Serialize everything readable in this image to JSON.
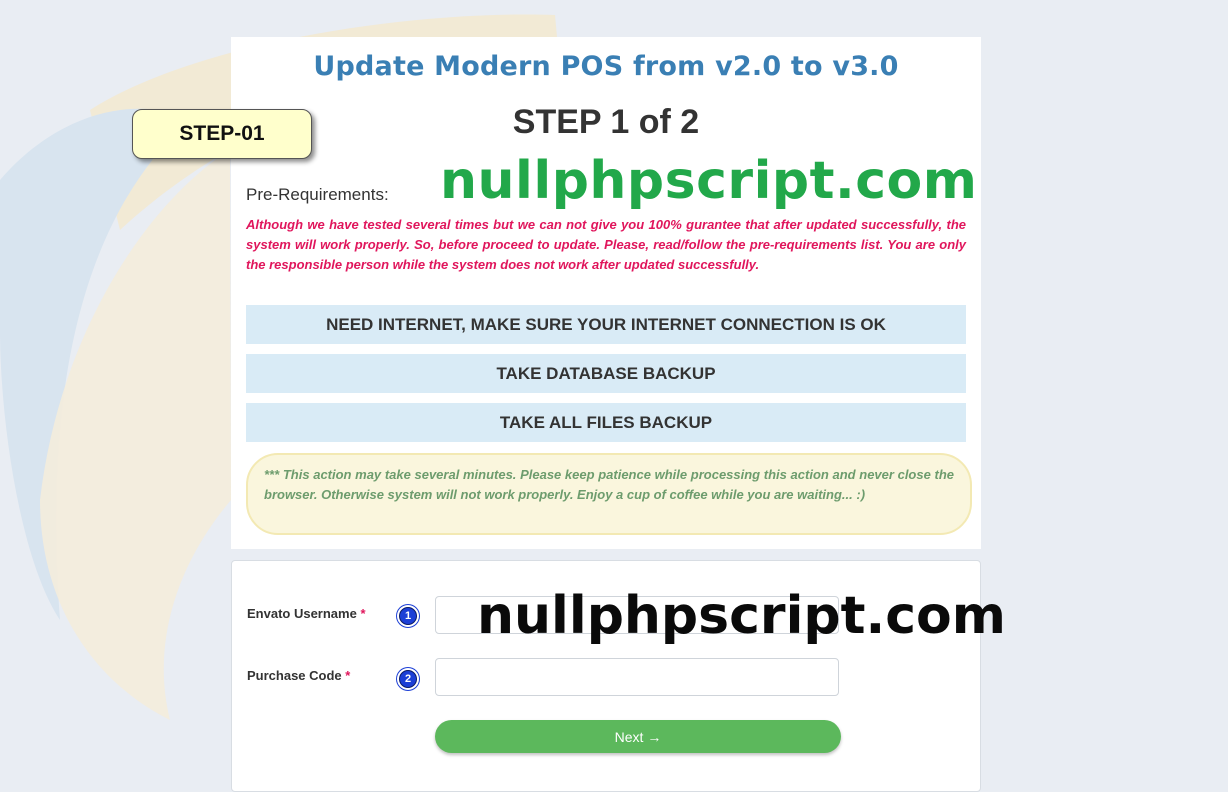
{
  "header": {
    "title": "Update Modern POS from v2.0 to v3.0",
    "step": "STEP 1 of 2",
    "step_badge": "STEP-01",
    "watermark": "nullphpscript.com"
  },
  "requirements": {
    "label": "Pre-Requirements:",
    "warning": "Although we have tested several times but we can not give you 100% gurantee that after updated successfully, the system will work properly. So, before proceed to update. Please, read/follow the pre-requirements list. You are only the responsible person while the system does not work after updated successfully.",
    "items": [
      "NEED INTERNET, MAKE SURE YOUR INTERNET CONNECTION IS OK",
      "TAKE DATABASE BACKUP",
      "TAKE ALL FILES BACKUP"
    ],
    "note": "*** This action may take several minutes. Please keep patience while processing this action and never close the browser. Otherwise system will not work properly. Enjoy a cup of coffee while you are waiting... :)"
  },
  "form": {
    "username_label": "Envato Username",
    "purchase_label": "Purchase Code",
    "required_mark": "*",
    "username_value": "",
    "purchase_value": "",
    "badge_1": "1",
    "badge_2": "2",
    "watermark": "nullphpscript.com",
    "next_label": "Next →"
  },
  "colors": {
    "title": "#3a7fb4",
    "warning": "#e0165c",
    "req_bg": "#d9ebf6",
    "note_text": "#6d9c6d",
    "next_button": "#5cb85c"
  }
}
